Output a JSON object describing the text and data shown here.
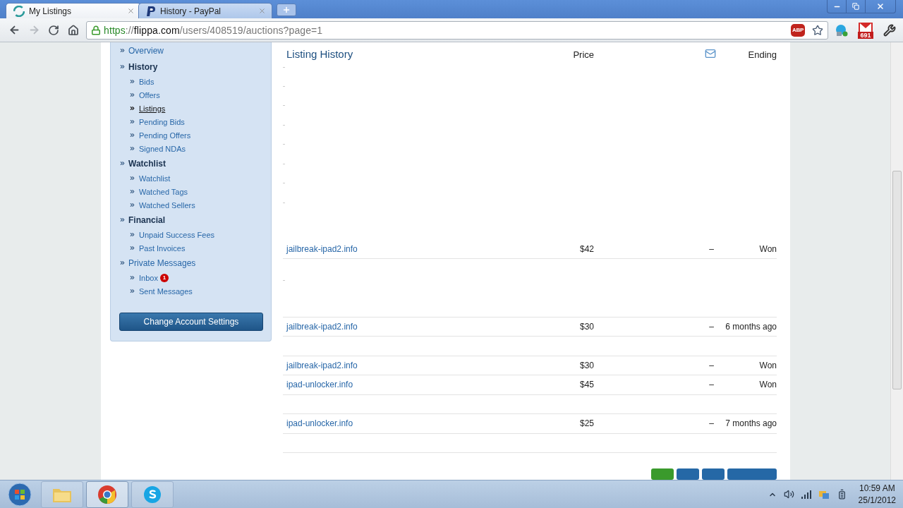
{
  "browser": {
    "tabs": [
      {
        "title": "My Listings",
        "kind": "flippa",
        "selected": true
      },
      {
        "title": "History - PayPal",
        "kind": "paypal",
        "selected": false
      }
    ],
    "address_bar": {
      "secure": true,
      "scheme": "https",
      "separator": "://",
      "host": "flippa.com",
      "path": "/users/408519/auctions?page=1"
    },
    "extensions": {
      "adblock_label": "ABP",
      "mail_count": "691"
    }
  },
  "sidebar": {
    "groups": [
      {
        "title": "Overview",
        "kind": "link"
      },
      {
        "title": "History",
        "kind": "heading",
        "items": [
          {
            "label": "Bids",
            "selected": false
          },
          {
            "label": "Offers",
            "selected": false
          },
          {
            "label": "Listings",
            "selected": true
          },
          {
            "label": "Pending Bids",
            "selected": false
          },
          {
            "label": "Pending Offers",
            "selected": false
          },
          {
            "label": "Signed NDAs",
            "selected": false
          }
        ]
      },
      {
        "title": "Watchlist",
        "kind": "heading",
        "items": [
          {
            "label": "Watchlist",
            "selected": false
          },
          {
            "label": "Watched Tags",
            "selected": false
          },
          {
            "label": "Watched Sellers",
            "selected": false
          }
        ]
      },
      {
        "title": "Financial",
        "kind": "heading",
        "items": [
          {
            "label": "Unpaid Success Fees",
            "selected": false
          },
          {
            "label": "Past Invoices",
            "selected": false
          }
        ]
      },
      {
        "title": "Private Messages",
        "kind": "link",
        "items": [
          {
            "label": "Inbox",
            "badge": "1",
            "selected": false
          },
          {
            "label": "Sent Messages",
            "selected": false
          }
        ]
      }
    ],
    "button": "Change Account Settings"
  },
  "listing_table": {
    "title": "Listing History",
    "price_header": "Price",
    "ending_header": "Ending",
    "rows": [
      {
        "kind": "collapsed"
      },
      {
        "kind": "collapsed"
      },
      {
        "kind": "collapsed"
      },
      {
        "kind": "collapsed"
      },
      {
        "kind": "collapsed"
      },
      {
        "kind": "collapsed"
      },
      {
        "kind": "collapsed"
      },
      {
        "kind": "collapsed"
      },
      {
        "kind": "spacer"
      },
      {
        "kind": "listing",
        "name": "jailbreak-ipad2.info",
        "price": "$42",
        "messages": "–",
        "ending": "Won"
      },
      {
        "kind": "spacer"
      },
      {
        "kind": "collapsed"
      },
      {
        "kind": "empty"
      },
      {
        "kind": "listing",
        "name": "jailbreak-ipad2.info",
        "price": "$30",
        "messages": "–",
        "ending": "6 months ago"
      },
      {
        "kind": "empty"
      },
      {
        "kind": "listing",
        "name": "jailbreak-ipad2.info",
        "price": "$30",
        "messages": "–",
        "ending": "Won"
      },
      {
        "kind": "listing",
        "name": "ipad-unlocker.info",
        "price": "$45",
        "messages": "–",
        "ending": "Won"
      },
      {
        "kind": "empty"
      },
      {
        "kind": "listing",
        "name": "ipad-unlocker.info",
        "price": "$25",
        "messages": "–",
        "ending": "7 months ago"
      },
      {
        "kind": "empty"
      }
    ],
    "pager": [
      {
        "selected": true
      },
      {
        "selected": false
      },
      {
        "selected": false
      },
      {
        "selected": false
      }
    ]
  },
  "taskbar": {
    "apps": [
      {
        "kind": "explorer",
        "selected": false
      },
      {
        "kind": "chrome",
        "selected": true
      },
      {
        "kind": "skype",
        "selected": false
      }
    ],
    "time": "10:59 AM",
    "date": "25/1/2012"
  }
}
